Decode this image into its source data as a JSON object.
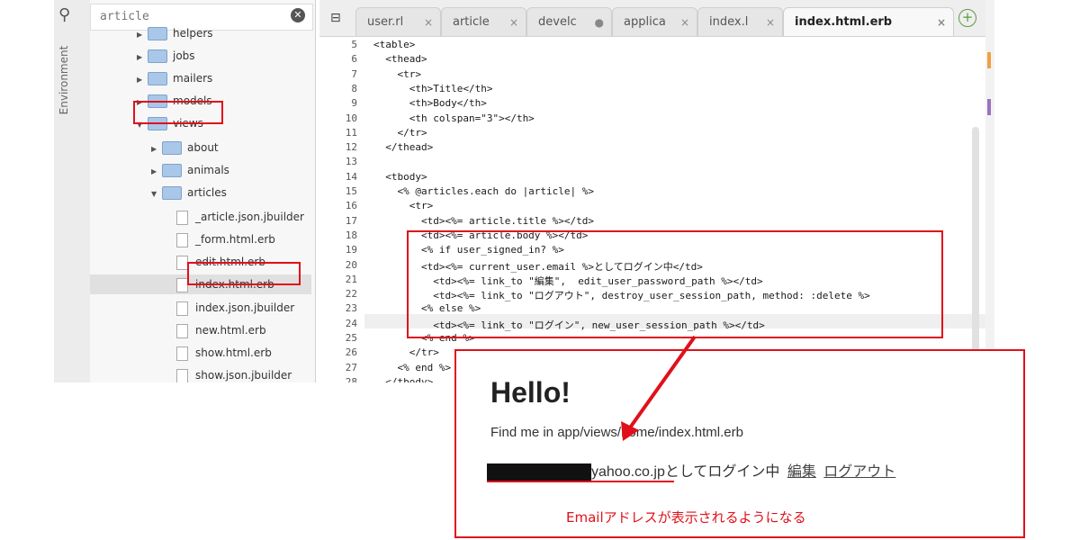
{
  "sidebar": {
    "search_value": "article",
    "env_label": "Environment",
    "items": [
      {
        "label": "helpers",
        "kind": "folder",
        "arrow": "▶"
      },
      {
        "label": "jobs",
        "kind": "folder",
        "arrow": "▶"
      },
      {
        "label": "mailers",
        "kind": "folder",
        "arrow": "▶"
      },
      {
        "label": "models",
        "kind": "folder",
        "arrow": "▶"
      },
      {
        "label": "views",
        "kind": "folder",
        "arrow": "▼"
      },
      {
        "label": "about",
        "kind": "folder",
        "arrow": "▶"
      },
      {
        "label": "animals",
        "kind": "folder",
        "arrow": "▶"
      },
      {
        "label": "articles",
        "kind": "folder",
        "arrow": "▼"
      },
      {
        "label": "_article.json.jbuilder",
        "kind": "file"
      },
      {
        "label": "_form.html.erb",
        "kind": "file"
      },
      {
        "label": "edit.html.erb",
        "kind": "file"
      },
      {
        "label": "index.html.erb",
        "kind": "file"
      },
      {
        "label": "index.json.jbuilder",
        "kind": "file"
      },
      {
        "label": "new.html.erb",
        "kind": "file"
      },
      {
        "label": "show.html.erb",
        "kind": "file"
      },
      {
        "label": "show.json.jbuilder",
        "kind": "file"
      }
    ]
  },
  "tabs": [
    {
      "label": "user.rl",
      "close": "×"
    },
    {
      "label": "article",
      "close": "×"
    },
    {
      "label": "develc",
      "close": "●"
    },
    {
      "label": "applica",
      "close": "×"
    },
    {
      "label": "index.l",
      "close": "×"
    },
    {
      "label": "index.html.erb",
      "close": "×"
    }
  ],
  "editor": {
    "line_numbers": [
      "5",
      "6",
      "7",
      "8",
      "9",
      "10",
      "11",
      "12",
      "13",
      "14",
      "15",
      "16",
      "17",
      "18",
      "19",
      "20",
      "21",
      "22",
      "23",
      "24",
      "25",
      "26",
      "27",
      "28"
    ],
    "lines": [
      "<table>",
      "  <thead>",
      "    <tr>",
      "      <th>Title</th>",
      "      <th>Body</th>",
      "      <th colspan=\"3\"></th>",
      "    </tr>",
      "  </thead>",
      "",
      "  <tbody>",
      "    <% @articles.each do |article| %>",
      "      <tr>",
      "        <td><%= article.title %></td>",
      "        <td><%= article.body %></td>",
      "        <% if user_signed_in? %>",
      "        <td><%= current_user.email %>としてログイン中</td>",
      "          <td><%= link_to \"編集\",  edit_user_password_path %></td>",
      "          <td><%= link_to \"ログアウト\", destroy_user_session_path, method: :delete %>",
      "        <% else %>",
      "          <td><%= link_to \"ログイン\", new_user_session_path %></td>",
      "        <% end %>",
      "      </tr>",
      "    <% end %>",
      "  </tbody>"
    ]
  },
  "preview": {
    "heading": "Hello!",
    "find_me": "Find me in app/views/home/index.html.erb",
    "email_suffix": "yahoo.co.jpとしてログイン中",
    "edit_link": "編集",
    "logout_link": "ログアウト",
    "note": "Emailアドレスが表示されるようになる"
  },
  "colors": {
    "annotation_red": "#e0101a",
    "folder_blue": "#a9c7e8"
  }
}
